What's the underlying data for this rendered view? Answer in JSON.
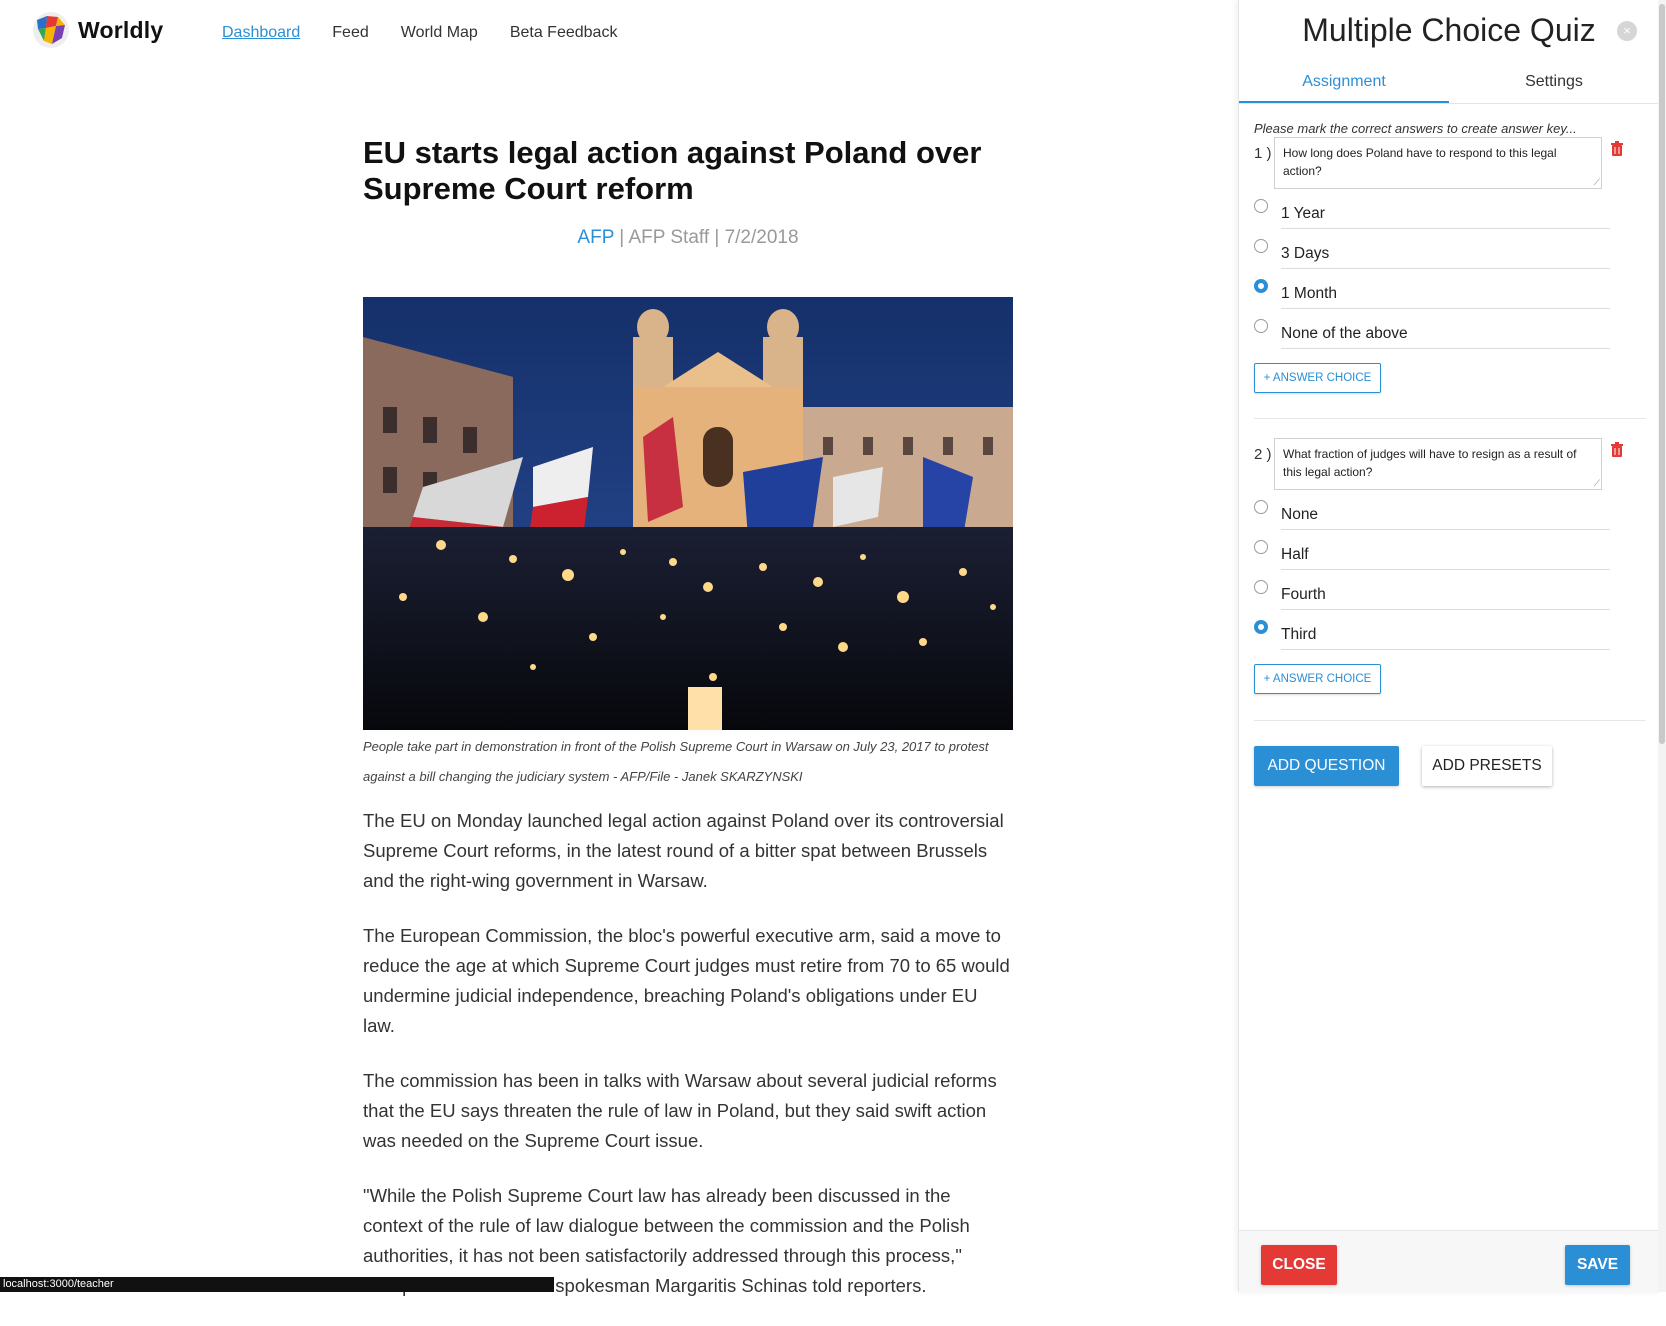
{
  "app": {
    "name": "Worldly"
  },
  "nav": {
    "items": [
      {
        "label": "Dashboard",
        "active": true
      },
      {
        "label": "Feed"
      },
      {
        "label": "World Map"
      },
      {
        "label": "Beta Feedback"
      }
    ]
  },
  "article": {
    "headline": "EU starts legal action against Poland over Supreme Court reform",
    "source": "AFP",
    "byline_rest": " | AFP Staff | 7/2/2018",
    "image_icon": "photo-candlelight-protest",
    "caption": "People take part in demonstration in front of the Polish Supreme Court in Warsaw on July 23, 2017 to protest against a bill changing the judiciary system - AFP/File - Janek SKARZYNSKI",
    "paragraphs": [
      "The EU on Monday launched legal action against Poland over its controversial Supreme Court reforms, in the latest round of a bitter spat between Brussels and the right-wing government in Warsaw.",
      "The European Commission, the bloc's powerful executive arm, said a move to reduce the age at which Supreme Court judges must retire from 70 to 65 would undermine judicial independence, breaching Poland's obligations under EU law.",
      "The commission has been in talks with Warsaw about several judicial reforms that the EU says threaten the rule of law in Poland, but they said swift action was needed on the Supreme Court issue.",
      "\"While the Polish Supreme Court law has already been discussed in the context of the rule of law dialogue between the commission and the Polish authorities, it has not been satisfactorily addressed through this process,\" European Commission spokesman Margaritis Schinas told reporters."
    ]
  },
  "statusbar": {
    "url": "localhost:3000/teacher"
  },
  "panel": {
    "title": "Multiple Choice Quiz",
    "tabs": [
      {
        "label": "Assignment",
        "active": true
      },
      {
        "label": "Settings"
      }
    ],
    "instructions": "Please mark the correct answers to create answer key...",
    "questions": [
      {
        "number": "1 )",
        "text": "How long does Poland have to respond to this legal action?",
        "choices": [
          {
            "label": "1 Year",
            "selected": false
          },
          {
            "label": "3 Days",
            "selected": false
          },
          {
            "label": "1 Month",
            "selected": true
          },
          {
            "label": "None of the above",
            "selected": false
          }
        ]
      },
      {
        "number": "2 )",
        "text": "What fraction of judges will have to resign as a result of this legal action?",
        "choices": [
          {
            "label": "None",
            "selected": false
          },
          {
            "label": "Half",
            "selected": false
          },
          {
            "label": "Fourth",
            "selected": false
          },
          {
            "label": "Third",
            "selected": true
          }
        ]
      }
    ],
    "add_choice_label": "+ ANSWER CHOICE",
    "add_question_label": "ADD QUESTION",
    "add_presets_label": "ADD PRESETS",
    "close_label": "CLOSE",
    "save_label": "SAVE",
    "close_icon": "×"
  },
  "colors": {
    "accent": "#2b8fd6",
    "danger": "#e53935"
  }
}
